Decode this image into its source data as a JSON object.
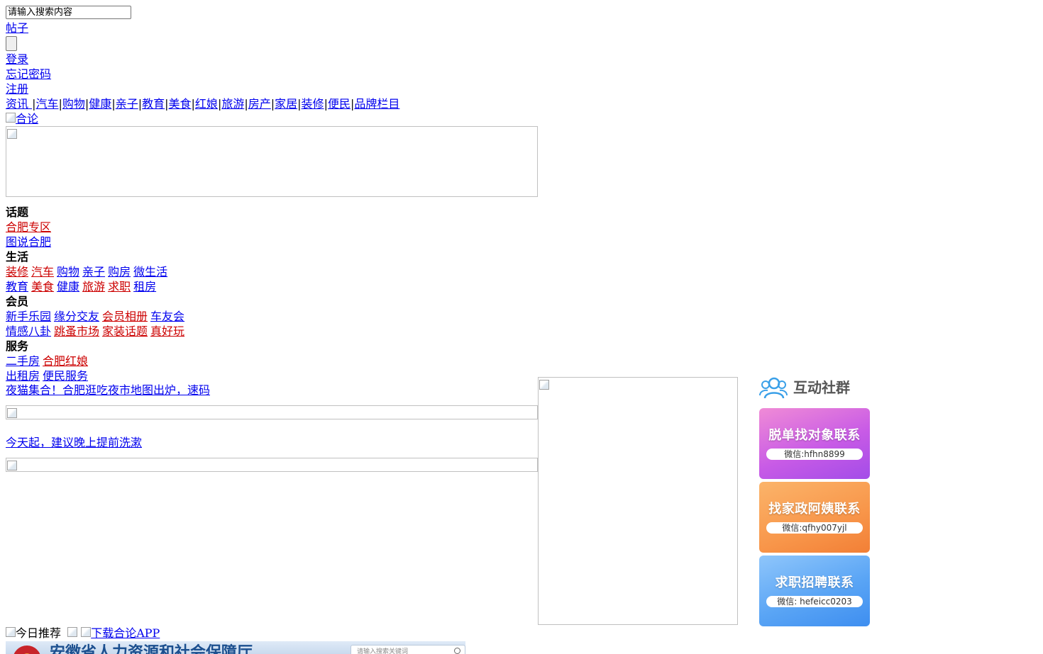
{
  "search": {
    "placeholder": "请输入搜索内容"
  },
  "top_links": {
    "posts": "帖子",
    "login": "登录",
    "forgot": "忘记密码",
    "register": "注册"
  },
  "nav": [
    {
      "label": "资讯 "
    },
    {
      "label": "汽车"
    },
    {
      "label": "购物"
    },
    {
      "label": "健康"
    },
    {
      "label": "亲子"
    },
    {
      "label": "教育"
    },
    {
      "label": "美食"
    },
    {
      "label": "红娘"
    },
    {
      "label": "旅游"
    },
    {
      "label": "房产"
    },
    {
      "label": "家居"
    },
    {
      "label": "装修"
    },
    {
      "label": "便民"
    },
    {
      "label": "品牌栏目"
    }
  ],
  "logo_alt": "合论",
  "sections": {
    "topic": {
      "title": "话题",
      "rows": [
        [
          {
            "label": "合肥专区",
            "hot": true
          }
        ],
        [
          {
            "label": "图说合肥",
            "hot": false
          }
        ]
      ]
    },
    "life": {
      "title": "生活",
      "rows": [
        [
          {
            "label": "装修",
            "hot": true
          },
          {
            "label": "汽车",
            "hot": true
          },
          {
            "label": "购物",
            "hot": false
          },
          {
            "label": "亲子",
            "hot": false
          },
          {
            "label": "购房",
            "hot": false
          },
          {
            "label": "微生活",
            "hot": false
          }
        ],
        [
          {
            "label": "教育",
            "hot": false
          },
          {
            "label": "美食",
            "hot": true
          },
          {
            "label": "健康",
            "hot": false
          },
          {
            "label": "旅游",
            "hot": true
          },
          {
            "label": "求职",
            "hot": true
          },
          {
            "label": "租房",
            "hot": false
          }
        ]
      ]
    },
    "member": {
      "title": "会员",
      "rows": [
        [
          {
            "label": "新手乐园",
            "hot": false
          },
          {
            "label": "缘分交友",
            "hot": false
          },
          {
            "label": "会员相册",
            "hot": true
          },
          {
            "label": "车友会",
            "hot": false
          }
        ],
        [
          {
            "label": "情感八卦",
            "hot": false
          },
          {
            "label": "跳蚤市场",
            "hot": true
          },
          {
            "label": "家装话题",
            "hot": true
          },
          {
            "label": "真好玩",
            "hot": true
          }
        ]
      ]
    },
    "service": {
      "title": "服务",
      "rows": [
        [
          {
            "label": "二手房",
            "hot": false
          },
          {
            "label": "合肥红娘",
            "hot": true
          }
        ],
        [
          {
            "label": "出租房",
            "hot": false
          },
          {
            "label": "便民服务",
            "hot": false
          }
        ]
      ]
    }
  },
  "articles": [
    {
      "title": "夜猫集合！合肥逛吃夜市地图出炉，速码"
    },
    {
      "title": "今天起，建议晚上提前洗漱"
    }
  ],
  "sidebar": {
    "title": "互动社群",
    "cards": [
      {
        "title": "脱单找对象联系",
        "wechat": "微信:hfhn8899"
      },
      {
        "title": "找家政阿姨联系",
        "wechat": "微信:qfhy007yjl"
      },
      {
        "title": "求职招聘联系",
        "wechat": "微信: hefeicc0203"
      }
    ]
  },
  "bottom": {
    "today_alt": "今日推荐",
    "app_alt": "下载合论APP"
  },
  "preview": {
    "title": "安徽省人力资源和社会保障厅",
    "search_placeholder": "请输入搜索关键词"
  }
}
